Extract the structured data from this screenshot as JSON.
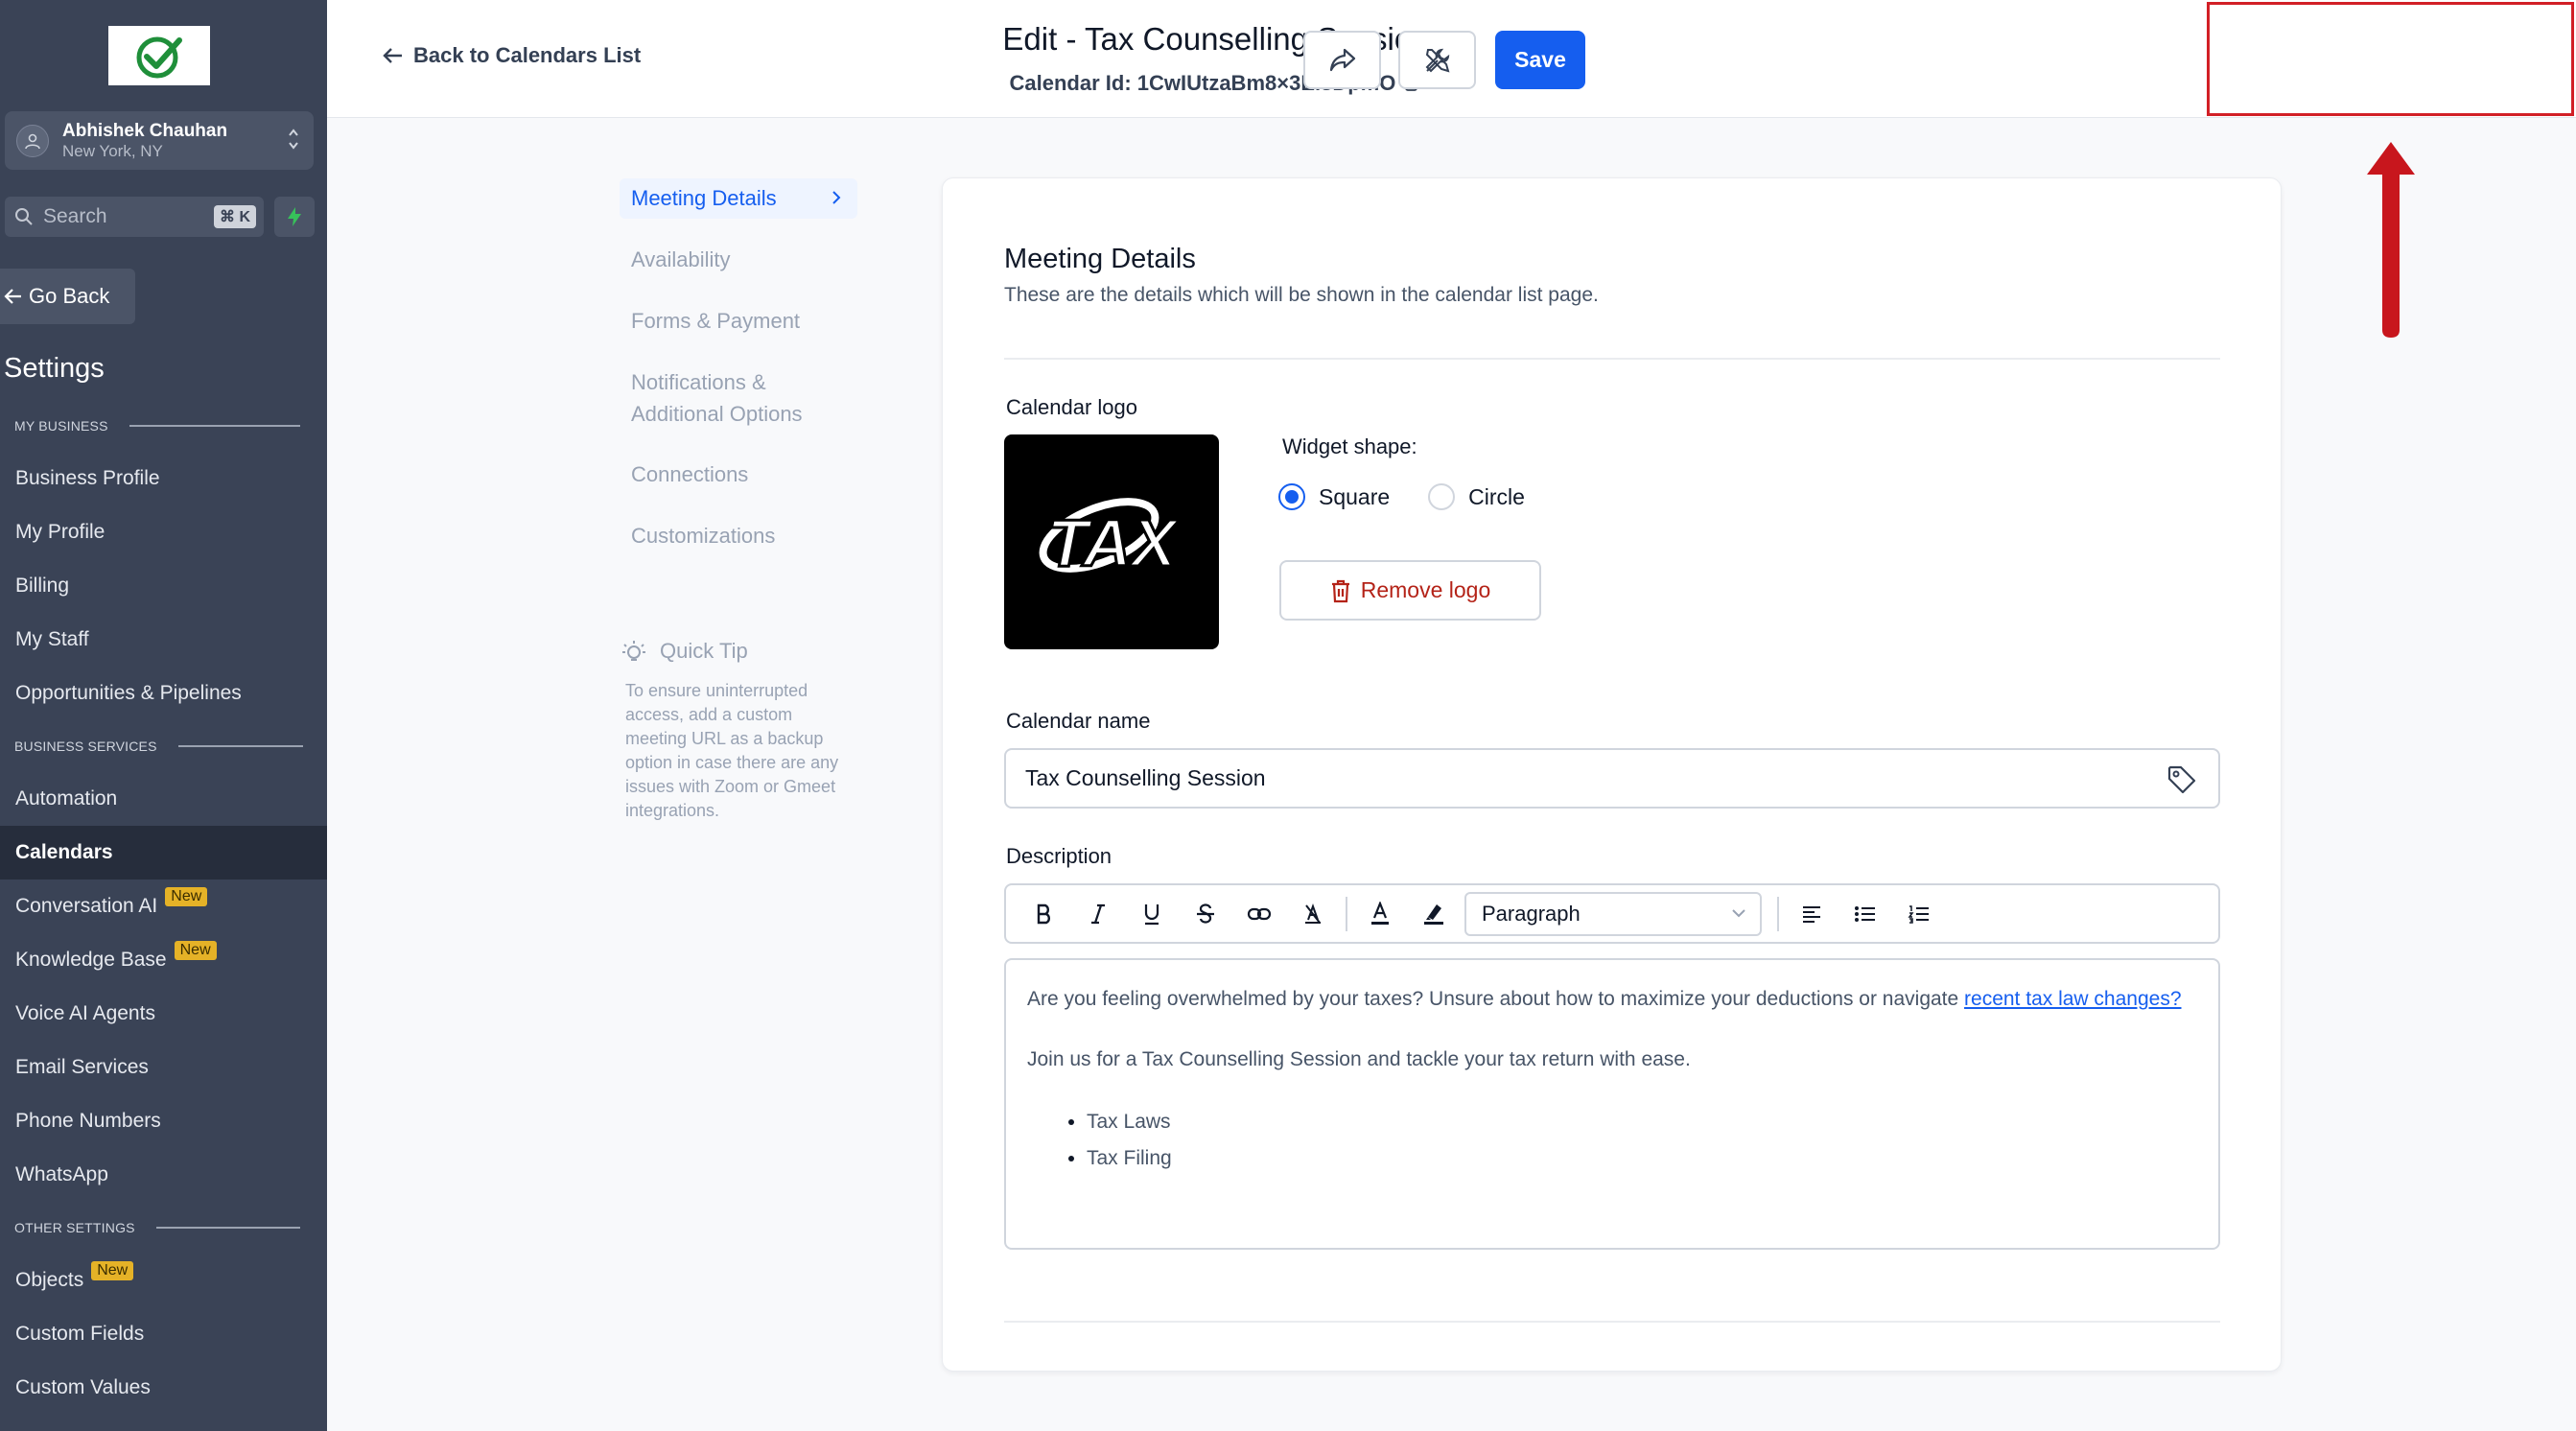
{
  "sidebar": {
    "user_name": "Abhishek Chauhan",
    "user_location": "New York, NY",
    "search_placeholder": "Search",
    "search_shortcut": "⌘ K",
    "go_back": "Go Back",
    "settings_title": "Settings",
    "sections": [
      {
        "title": "MY BUSINESS"
      },
      {
        "title": "BUSINESS SERVICES"
      },
      {
        "title": "OTHER SETTINGS"
      }
    ],
    "items": [
      {
        "label": "Business Profile"
      },
      {
        "label": "My Profile"
      },
      {
        "label": "Billing"
      },
      {
        "label": "My Staff"
      },
      {
        "label": "Opportunities & Pipelines"
      },
      {
        "label": "Automation"
      },
      {
        "label": "Calendars"
      },
      {
        "label": "Conversation AI",
        "badge": "New"
      },
      {
        "label": "Knowledge Base",
        "badge": "New"
      },
      {
        "label": "Voice AI Agents"
      },
      {
        "label": "Email Services"
      },
      {
        "label": "Phone Numbers"
      },
      {
        "label": "WhatsApp"
      },
      {
        "label": "Objects",
        "badge": "New"
      },
      {
        "label": "Custom Fields"
      },
      {
        "label": "Custom Values"
      }
    ],
    "active_item": "Calendars"
  },
  "header": {
    "back_link": "Back to Calendars List",
    "title": "Edit - Tax Counselling Session",
    "calendar_id": "Calendar Id: 1CwIUtzaBm8×3EisDpmO",
    "save_label": "Save"
  },
  "subnav": {
    "items": [
      {
        "label": "Meeting Details"
      },
      {
        "label": "Availability"
      },
      {
        "label": "Forms & Payment"
      },
      {
        "label": "Notifications &"
      },
      {
        "label": "Additional Options"
      },
      {
        "label": "Connections"
      },
      {
        "label": "Customizations"
      }
    ],
    "active": "Meeting Details",
    "quick_tip_title": "Quick Tip",
    "quick_tip_text": "To ensure uninterrupted access, add a custom meeting URL as a backup option in case there are any issues with Zoom or Gmeet integrations."
  },
  "card": {
    "title": "Meeting Details",
    "subtitle": "These are the details which will be shown in the calendar list page.",
    "logo_label": "Calendar logo",
    "logo_text": "TAX",
    "widget_shape_label": "Widget shape:",
    "shape_options": [
      "Square",
      "Circle"
    ],
    "shape_selected": "Square",
    "remove_logo": "Remove logo",
    "name_label": "Calendar name",
    "name_value": "Tax Counselling Session",
    "description_label": "Description",
    "block_format": "Paragraph",
    "description": {
      "para1_text": "Are you feeling overwhelmed by your taxes? Unsure about how to maximize your deductions or navigate ",
      "para1_link": "recent tax law changes?",
      "para2": "Join us for a Tax Counselling Session and tackle your tax return with ease.",
      "bullets": [
        "Tax Laws",
        "Tax Filing"
      ]
    }
  },
  "colors": {
    "sidebar_bg": "#3a4356",
    "accent": "#155eef",
    "highlight": "#d21f26",
    "badge": "#e5b227"
  }
}
